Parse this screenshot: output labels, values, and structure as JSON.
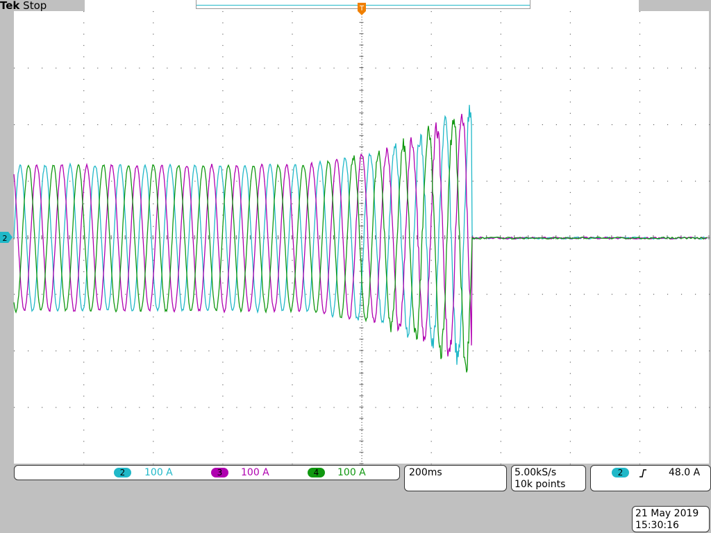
{
  "header": {
    "brand": "Tek",
    "run_state": "Stop"
  },
  "trigger_marker": {
    "label": "T"
  },
  "ground_marker": {
    "channel": "2"
  },
  "channels": [
    {
      "number": "2",
      "scale": "100 A",
      "color": "#20b8c8"
    },
    {
      "number": "3",
      "scale": "100 A",
      "color": "#b000b0"
    },
    {
      "number": "4",
      "scale": "100 A",
      "color": "#109810"
    }
  ],
  "timebase": {
    "label": "200ms"
  },
  "acquisition": {
    "sample_rate": "5.00kS/s",
    "record_length": "10k points"
  },
  "trigger": {
    "source": "2",
    "slope_icon": "rising-edge-icon",
    "level": "48.0 A"
  },
  "datetime": {
    "date": "21 May 2019",
    "time": "15:30:16"
  },
  "colors": {
    "grid": "#555555",
    "background": "#ffffff"
  }
}
